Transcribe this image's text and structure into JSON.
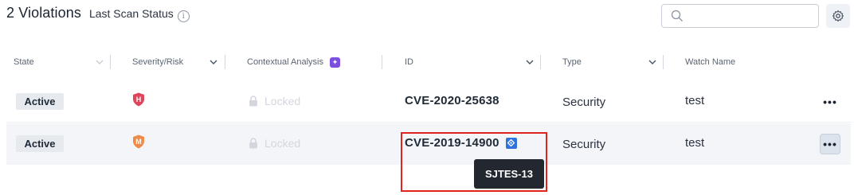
{
  "header": {
    "title": "2 Violations",
    "subtitle": "Last Scan Status",
    "info_glyph": "i"
  },
  "search": {
    "placeholder": "",
    "value": ""
  },
  "columns": [
    {
      "label": "State",
      "sortable": true
    },
    {
      "label": "Severity/Risk",
      "sortable": true
    },
    {
      "label": "Contextual Analysis",
      "sortable": false,
      "badge": "ai-sparkle-icon"
    },
    {
      "label": "ID",
      "sortable": true
    },
    {
      "label": "Type",
      "sortable": true
    },
    {
      "label": "Watch Name",
      "sortable": false
    }
  ],
  "rows": [
    {
      "state": "Active",
      "severity_letter": "H",
      "severity_color": "#e0455b",
      "contextual": "Locked",
      "id": "CVE-2020-25638",
      "type": "Security",
      "watch": "test",
      "more": "•••"
    },
    {
      "state": "Active",
      "severity_letter": "M",
      "severity_color": "#f08a4b",
      "contextual": "Locked",
      "id": "CVE-2019-14900",
      "jira_icon": "jira-ticket-icon",
      "type": "Security",
      "watch": "test",
      "more": "•••"
    }
  ],
  "tooltip": {
    "text": "SJTES-13"
  },
  "colors": {
    "accent_purple": "#7b4fe0",
    "jira_blue": "#2f74db",
    "highlight_red": "#e0231f",
    "tooltip_bg": "#232830"
  }
}
